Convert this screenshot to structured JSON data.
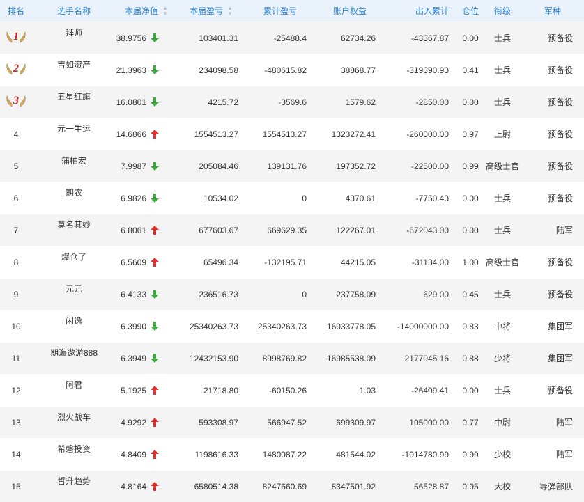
{
  "headers": {
    "rank": "排名",
    "name": "选手名称",
    "nav": "本届净值",
    "profit": "本届盈亏",
    "total_profit": "累计盈亏",
    "equity": "账户权益",
    "flow": "出入累计",
    "position": "仓位",
    "grade": "衔级",
    "branch": "军种"
  },
  "colors": {
    "header_text": "#2a80d2",
    "up": "#e03030",
    "down": "#3ea93e",
    "rank_medal": "#cc2222"
  },
  "rows": [
    {
      "rank": "1",
      "name": "拜师",
      "nav": "38.9756",
      "dir": "down",
      "profit": "103401.31",
      "total_profit": "-25488.4",
      "equity": "62734.26",
      "flow": "-43367.87",
      "position": "0.00",
      "grade": "士兵",
      "branch": "预备役"
    },
    {
      "rank": "2",
      "name": "吉如资产",
      "nav": "21.3963",
      "dir": "down",
      "profit": "234098.58",
      "total_profit": "-480615.82",
      "equity": "38868.77",
      "flow": "-319390.93",
      "position": "0.41",
      "grade": "士兵",
      "branch": "预备役"
    },
    {
      "rank": "3",
      "name": "五星红旗",
      "nav": "16.0801",
      "dir": "down",
      "profit": "4215.72",
      "total_profit": "-3569.6",
      "equity": "1579.62",
      "flow": "-2850.00",
      "position": "0.00",
      "grade": "士兵",
      "branch": "预备役"
    },
    {
      "rank": "4",
      "name": "元一生运",
      "nav": "14.6866",
      "dir": "up",
      "profit": "1554513.27",
      "total_profit": "1554513.27",
      "equity": "1323272.41",
      "flow": "-260000.00",
      "position": "0.97",
      "grade": "上尉",
      "branch": "预备役"
    },
    {
      "rank": "5",
      "name": "蒲柏宏",
      "nav": "7.9987",
      "dir": "down",
      "profit": "205084.46",
      "total_profit": "139131.76",
      "equity": "197352.72",
      "flow": "-22500.00",
      "position": "0.99",
      "grade": "高级士官",
      "branch": "预备役"
    },
    {
      "rank": "6",
      "name": "期农",
      "nav": "6.9826",
      "dir": "down",
      "profit": "10534.02",
      "total_profit": "0",
      "equity": "4370.61",
      "flow": "-7750.43",
      "position": "0.00",
      "grade": "士兵",
      "branch": "预备役"
    },
    {
      "rank": "7",
      "name": "莫名其妙",
      "nav": "6.8061",
      "dir": "up",
      "profit": "677603.67",
      "total_profit": "669629.35",
      "equity": "122267.01",
      "flow": "-672043.00",
      "position": "0.00",
      "grade": "士兵",
      "branch": "陆军"
    },
    {
      "rank": "8",
      "name": "爆仓了",
      "nav": "6.5609",
      "dir": "up",
      "profit": "65496.34",
      "total_profit": "-132195.71",
      "equity": "44215.05",
      "flow": "-31134.00",
      "position": "1.00",
      "grade": "高级士官",
      "branch": "预备役"
    },
    {
      "rank": "9",
      "name": "元元",
      "nav": "6.4133",
      "dir": "down",
      "profit": "236516.73",
      "total_profit": "0",
      "equity": "237758.09",
      "flow": "629.00",
      "position": "0.45",
      "grade": "士兵",
      "branch": "预备役"
    },
    {
      "rank": "10",
      "name": "闲逸",
      "nav": "6.3990",
      "dir": "down",
      "profit": "25340263.73",
      "total_profit": "25340263.73",
      "equity": "16033778.05",
      "flow": "-14000000.00",
      "position": "0.83",
      "grade": "中将",
      "branch": "集团军"
    },
    {
      "rank": "11",
      "name": "期海遨游888",
      "nav": "6.3949",
      "dir": "down",
      "profit": "12432153.90",
      "total_profit": "8998769.82",
      "equity": "16985538.09",
      "flow": "2177045.16",
      "position": "0.88",
      "grade": "少将",
      "branch": "集团军"
    },
    {
      "rank": "12",
      "name": "阿君",
      "nav": "5.1925",
      "dir": "up",
      "profit": "21718.80",
      "total_profit": "-60150.26",
      "equity": "1.03",
      "flow": "-26409.41",
      "position": "0.00",
      "grade": "士兵",
      "branch": "预备役"
    },
    {
      "rank": "13",
      "name": "烈火战车",
      "nav": "4.9292",
      "dir": "up",
      "profit": "593308.97",
      "total_profit": "566947.52",
      "equity": "699309.97",
      "flow": "105000.00",
      "position": "0.77",
      "grade": "中尉",
      "branch": "陆军"
    },
    {
      "rank": "14",
      "name": "希磐投资",
      "nav": "4.8409",
      "dir": "up",
      "profit": "1198616.33",
      "total_profit": "1480087.22",
      "equity": "481544.02",
      "flow": "-1014780.99",
      "position": "0.99",
      "grade": "少校",
      "branch": "陆军"
    },
    {
      "rank": "15",
      "name": "皙升趋势",
      "nav": "4.8164",
      "dir": "up",
      "profit": "6580514.38",
      "total_profit": "8247660.69",
      "equity": "8347501.92",
      "flow": "56528.87",
      "position": "0.95",
      "grade": "大校",
      "branch": "导弹部队"
    }
  ]
}
